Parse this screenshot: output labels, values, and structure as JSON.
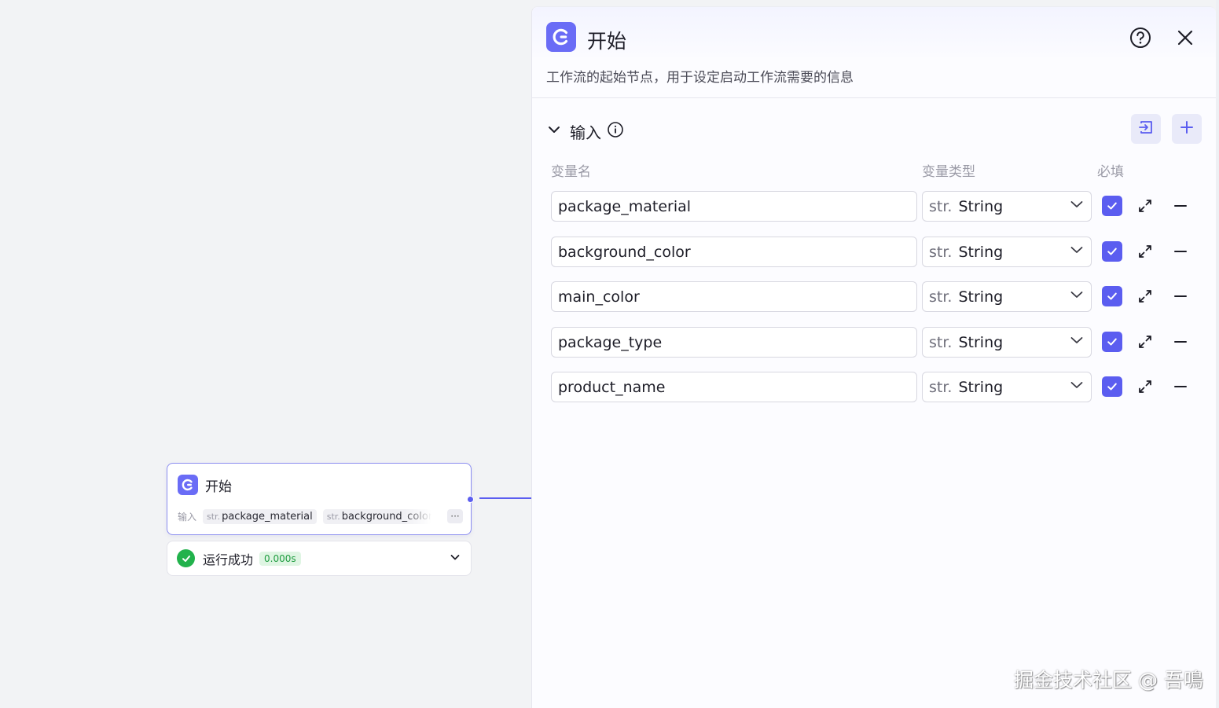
{
  "node": {
    "title": "开始",
    "inputs_label": "输入",
    "inputs": [
      {
        "type": "str.",
        "name": "package_material"
      },
      {
        "type": "str.",
        "name": "background_color"
      }
    ],
    "more": "···",
    "run_status": "运行成功",
    "run_time": "0.000s"
  },
  "panel": {
    "title": "开始",
    "description": "工作流的起始节点，用于设定启动工作流需要的信息",
    "section_title": "输入",
    "columns": {
      "name": "变量名",
      "type": "变量类型",
      "required": "必填"
    },
    "variables": [
      {
        "name": "package_material",
        "type_prefix": "str.",
        "type": "String",
        "required": true
      },
      {
        "name": "background_color",
        "type_prefix": "str.",
        "type": "String",
        "required": true
      },
      {
        "name": "main_color",
        "type_prefix": "str.",
        "type": "String",
        "required": true
      },
      {
        "name": "package_type",
        "type_prefix": "str.",
        "type": "String",
        "required": true
      },
      {
        "name": "product_name",
        "type_prefix": "str.",
        "type": "String",
        "required": true
      }
    ]
  },
  "watermark": "掘金技术社区 @ 吾鳴",
  "icons": {
    "node_icon": "workflow-start-icon",
    "help": "question-circle-icon",
    "close": "close-icon",
    "collapse": "chevron-down-icon",
    "info": "info-circle-icon",
    "import": "import-icon",
    "add": "plus-icon",
    "expand": "expand-icon",
    "remove": "minus-icon",
    "success": "check-circle-icon"
  },
  "colors": {
    "accent": "#5b5df0",
    "success": "#22b24c"
  }
}
